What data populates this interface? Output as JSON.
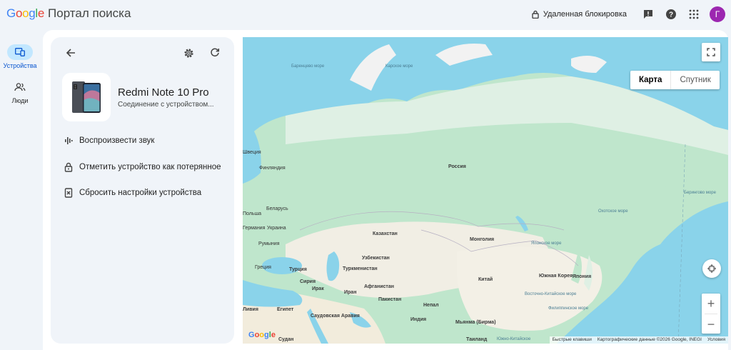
{
  "header": {
    "logo_text": "Google",
    "title": "Портал поиска",
    "lock_label": "Удаленная блокировка",
    "avatar_letter": "Г"
  },
  "rail": {
    "items": [
      {
        "label": "Устройства",
        "icon": "devices-icon",
        "active": true
      },
      {
        "label": "Люди",
        "icon": "people-icon",
        "active": false
      }
    ]
  },
  "device": {
    "name": "Redmi Note 10 Pro",
    "status": "Соединение с устройством..."
  },
  "actions": [
    {
      "label": "Воспроизвести звук",
      "icon": "sound-icon"
    },
    {
      "label": "Отметить устройство как потерянное",
      "icon": "lock-icon"
    },
    {
      "label": "Сбросить настройки устройства",
      "icon": "erase-device-icon"
    }
  ],
  "map": {
    "type_map": "Карта",
    "type_satellite": "Спутник",
    "zoom_in": "+",
    "zoom_out": "−",
    "google_logo": "Google",
    "attribution": [
      "Быстрые клавиши",
      "Картографические данные ©2026 Google, INEGI",
      "Условия"
    ],
    "labels": {
      "russia": "Россия",
      "kazakhstan": "Казахстан",
      "mongolia": "Монголия",
      "china": "Китай",
      "uzbekistan": "Узбекистан",
      "turkmenistan": "Туркменистан",
      "afghanistan": "Афганистан",
      "pakistan": "Пакистан",
      "iran": "Иран",
      "iraq": "Ирак",
      "turkey": "Турция",
      "syria": "Сирия",
      "ukraine": "Украина",
      "belarus": "Беларусь",
      "poland": "Польша",
      "romania": "Румыния",
      "greece": "Греция",
      "finland": "Финляндия",
      "sweden": "Швеция",
      "germany": "Германия",
      "egypt": "Египет",
      "libya": "Ливия",
      "saudi": "Саудовская Аравия",
      "sudan": "Судан",
      "nepal": "Непал",
      "india": "Индия",
      "myanmar": "Мьянма (Бирма)",
      "thailand": "Таиланд",
      "japan": "Япония",
      "skorea": "Южная Корея",
      "barents": "Баренцево море",
      "kara": "Карское море",
      "bering": "Берингово море",
      "okhotsk": "Охотское море",
      "japan_sea": "Японское море",
      "ecs": "Восточно-Китайское море",
      "philippine": "Филиппинское море",
      "scs": "Южно-Китайское"
    }
  }
}
